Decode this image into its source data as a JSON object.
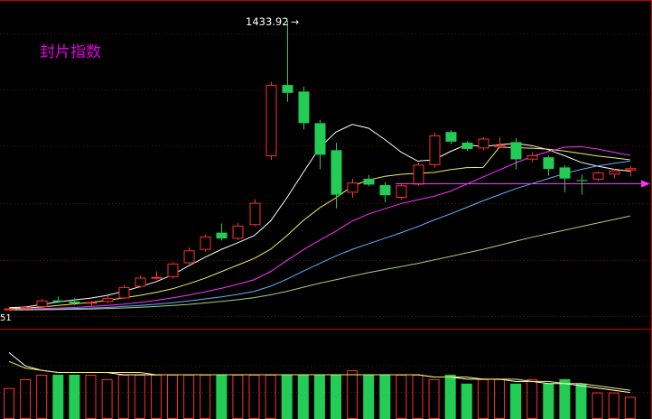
{
  "title": "封片指数",
  "colors": {
    "background": "#000000",
    "border": "#c00000",
    "grid": "#6e1010",
    "up": "#ff3030",
    "down": "#22cc55",
    "title": "#e000e0",
    "label": "#ffffff",
    "ma_white": "#ffffff",
    "ma_yellow": "#f0f060",
    "ma_magenta": "#ff30ff",
    "ma_blue": "#60b0ff",
    "ma_green": "#a6cf80",
    "vol_line_white": "#ffffff",
    "vol_line_yellow": "#f0f060"
  },
  "labels": {
    "high_annotation": "1433.92",
    "left_edge_value": "51"
  },
  "chart_data": {
    "type": "candlestick",
    "title": "封片指数",
    "ylim": [
      350,
      1500
    ],
    "candles": [
      {
        "o": 360,
        "h": 368,
        "l": 354,
        "c": 362
      },
      {
        "o": 362,
        "h": 372,
        "l": 358,
        "c": 368
      },
      {
        "o": 368,
        "h": 400,
        "l": 364,
        "c": 394
      },
      {
        "o": 394,
        "h": 410,
        "l": 385,
        "c": 388
      },
      {
        "o": 390,
        "h": 402,
        "l": 376,
        "c": 382
      },
      {
        "o": 382,
        "h": 392,
        "l": 372,
        "c": 388
      },
      {
        "o": 388,
        "h": 412,
        "l": 383,
        "c": 403
      },
      {
        "o": 402,
        "h": 455,
        "l": 398,
        "c": 447
      },
      {
        "o": 448,
        "h": 491,
        "l": 444,
        "c": 484
      },
      {
        "o": 484,
        "h": 509,
        "l": 476,
        "c": 487
      },
      {
        "o": 486,
        "h": 545,
        "l": 480,
        "c": 540
      },
      {
        "o": 541,
        "h": 604,
        "l": 536,
        "c": 592
      },
      {
        "o": 594,
        "h": 654,
        "l": 588,
        "c": 647
      },
      {
        "o": 662,
        "h": 698,
        "l": 631,
        "c": 639
      },
      {
        "o": 638,
        "h": 701,
        "l": 632,
        "c": 690
      },
      {
        "o": 692,
        "h": 794,
        "l": 686,
        "c": 780
      },
      {
        "o": 964,
        "h": 1258,
        "l": 950,
        "c": 1246
      },
      {
        "o": 1246,
        "h": 1434,
        "l": 1180,
        "c": 1215
      },
      {
        "o": 1220,
        "h": 1240,
        "l": 1070,
        "c": 1095
      },
      {
        "o": 1095,
        "h": 1108,
        "l": 913,
        "c": 970
      },
      {
        "o": 988,
        "h": 1018,
        "l": 758,
        "c": 812
      },
      {
        "o": 820,
        "h": 875,
        "l": 800,
        "c": 860
      },
      {
        "o": 875,
        "h": 890,
        "l": 845,
        "c": 852
      },
      {
        "o": 850,
        "h": 862,
        "l": 782,
        "c": 810
      },
      {
        "o": 800,
        "h": 855,
        "l": 793,
        "c": 849
      },
      {
        "o": 852,
        "h": 940,
        "l": 848,
        "c": 931
      },
      {
        "o": 929,
        "h": 1057,
        "l": 919,
        "c": 1047
      },
      {
        "o": 1060,
        "h": 1068,
        "l": 1012,
        "c": 1022
      },
      {
        "o": 1018,
        "h": 1024,
        "l": 985,
        "c": 993
      },
      {
        "o": 995,
        "h": 1040,
        "l": 988,
        "c": 1034
      },
      {
        "o": 999,
        "h": 1040,
        "l": 997,
        "c": 1008
      },
      {
        "o": 1020,
        "h": 1036,
        "l": 912,
        "c": 952
      },
      {
        "o": 951,
        "h": 980,
        "l": 941,
        "c": 968
      },
      {
        "o": 960,
        "h": 967,
        "l": 887,
        "c": 914
      },
      {
        "o": 920,
        "h": 928,
        "l": 822,
        "c": 876
      },
      {
        "o": 870,
        "h": 892,
        "l": 812,
        "c": 866
      },
      {
        "o": 872,
        "h": 905,
        "l": 866,
        "c": 900
      },
      {
        "o": 892,
        "h": 914,
        "l": 877,
        "c": 908
      },
      {
        "o": 908,
        "h": 925,
        "l": 884,
        "c": 917
      }
    ],
    "ma_lines": [
      {
        "color_key": "ma_white",
        "values": [
          365,
          368,
          378,
          388,
          396,
          403,
          414,
          430,
          448,
          468,
          495,
          531,
          565,
          596,
          622,
          650,
          708,
          800,
          900,
          998,
          1060,
          1090,
          1075,
          1030,
          980,
          945,
          950,
          983,
          1010,
          1002,
          1010,
          1015,
          1006,
          990,
          966,
          940,
          925,
          913,
          905
        ]
      },
      {
        "color_key": "ma_yellow",
        "values": [
          362,
          364,
          368,
          374,
          380,
          386,
          394,
          404,
          414,
          426,
          440,
          460,
          482,
          508,
          534,
          560,
          596,
          650,
          710,
          760,
          800,
          846,
          870,
          885,
          893,
          897,
          900,
          911,
          919,
          920,
          1000,
          998,
          996,
          992,
          985,
          975,
          965,
          958,
          950
        ]
      },
      {
        "color_key": "ma_magenta",
        "values": [
          359,
          360,
          362,
          364,
          366,
          370,
          374,
          379,
          386,
          394,
          404,
          415,
          428,
          442,
          458,
          476,
          508,
          552,
          594,
          632,
          668,
          708,
          736,
          757,
          777,
          792,
          806,
          826,
          854,
          882,
          910,
          938,
          963,
          983,
          1000,
          1002,
          993,
          980,
          968
        ]
      },
      {
        "color_key": "ma_blue",
        "values": [
          357,
          358,
          359,
          360,
          362,
          364,
          366,
          370,
          374,
          379,
          385,
          392,
          400,
          408,
          418,
          430,
          450,
          478,
          510,
          540,
          570,
          596,
          618,
          640,
          662,
          686,
          712,
          736,
          762,
          788,
          812,
          836,
          856,
          876,
          896,
          912,
          926,
          936,
          945
        ]
      },
      {
        "color_key": "ma_green",
        "values": [
          356,
          356.5,
          357,
          358,
          359,
          360,
          362,
          364,
          367,
          370,
          374,
          378,
          384,
          390,
          397,
          405,
          416,
          430,
          446,
          462,
          476,
          490,
          504,
          516,
          528,
          540,
          554,
          568,
          582,
          596,
          612,
          628,
          644,
          658,
          672,
          686,
          700,
          714,
          728
        ]
      }
    ],
    "reference_line": {
      "value": 858,
      "color_key": "ma_magenta"
    },
    "volume": {
      "bars": [
        14,
        18,
        20,
        20,
        20,
        20,
        18,
        20,
        20,
        20,
        20,
        20,
        20,
        20,
        20,
        20,
        20,
        20,
        20,
        20,
        20,
        22,
        20,
        20,
        20,
        20,
        18,
        20,
        16,
        18,
        18,
        16,
        18,
        16,
        18,
        16,
        12,
        12,
        10
      ],
      "line_white": [
        30,
        24,
        22,
        21,
        21,
        21,
        21,
        20,
        20,
        20,
        20,
        20,
        20,
        20,
        20,
        20,
        20,
        20,
        20,
        20,
        20,
        20,
        20,
        20,
        20,
        20,
        19,
        19,
        18,
        18,
        18,
        17,
        17,
        16,
        16,
        15,
        14,
        13,
        12
      ],
      "line_yellow": [
        26,
        23,
        22,
        21,
        21,
        21,
        21,
        21,
        21,
        20,
        20,
        20,
        20,
        20,
        20,
        20,
        20,
        20,
        20,
        20,
        20,
        20,
        20,
        20,
        20,
        20,
        19,
        19,
        19,
        18,
        18,
        18,
        17,
        17,
        16,
        16,
        15,
        14,
        13
      ],
      "ylim": [
        0,
        40
      ]
    }
  }
}
